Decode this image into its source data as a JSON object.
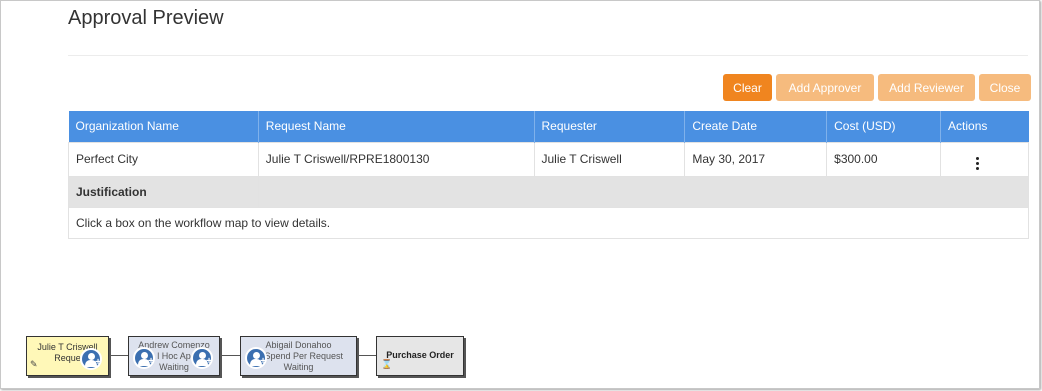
{
  "page": {
    "title": "Approval Preview"
  },
  "toolbar": {
    "clear": "Clear",
    "add_approver": "Add Approver",
    "add_reviewer": "Add Reviewer",
    "close": "Close"
  },
  "colors": {
    "header": "#4a90e2",
    "primary": "#f0851f",
    "secondary": "#f6bb7e"
  },
  "table": {
    "columns": [
      "Organization Name",
      "Request Name",
      "Requester",
      "Create Date",
      "Cost (USD)",
      "Actions"
    ],
    "row": {
      "organization": "Perfect City",
      "request_name": "Julie T Criswell/RPRE1800130",
      "requester": "Julie T Criswell",
      "create_date": "May 30, 2017",
      "cost": "$300.00",
      "actions_icon": "kebab-menu-icon"
    },
    "justification_label": "Justification",
    "info_text": "Click a box on the workflow map to view details."
  },
  "workflow": {
    "nodes": [
      {
        "line1": "Julie T Criswell",
        "line2": "Reque"
      },
      {
        "line1": "Andrew Comenzo",
        "line2": "l Hoc Ap",
        "line3": "Waiting"
      },
      {
        "line1": "Abigail Donahoo",
        "line2": "er Spend Per Request",
        "line3": "Waiting"
      },
      {
        "line1": "Purchase Order"
      }
    ],
    "icons": {
      "add_user": "add-user-icon",
      "hourglass": "hourglass-icon",
      "edit": "edit-icon"
    }
  }
}
